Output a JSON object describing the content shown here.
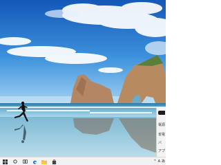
{
  "taskbar": {
    "start": "start-icon",
    "search": "search-icon",
    "task_view": "task-view-icon",
    "edge": "edge-browser-icon",
    "explorer": "file-explorer-icon",
    "store": "store-icon",
    "tray": {
      "chevron": "^",
      "ime": "A",
      "ime_mode": "あ"
    }
  },
  "flyout": {
    "lines": [
      "電源",
      "省電",
      "バ",
      "アプ"
    ]
  },
  "colors": {
    "taskbar_bg": "#f2f2f2",
    "sky_top": "#1f6fc6",
    "sky_bottom": "#8fc4ef",
    "sea": "#3a7fa8"
  }
}
